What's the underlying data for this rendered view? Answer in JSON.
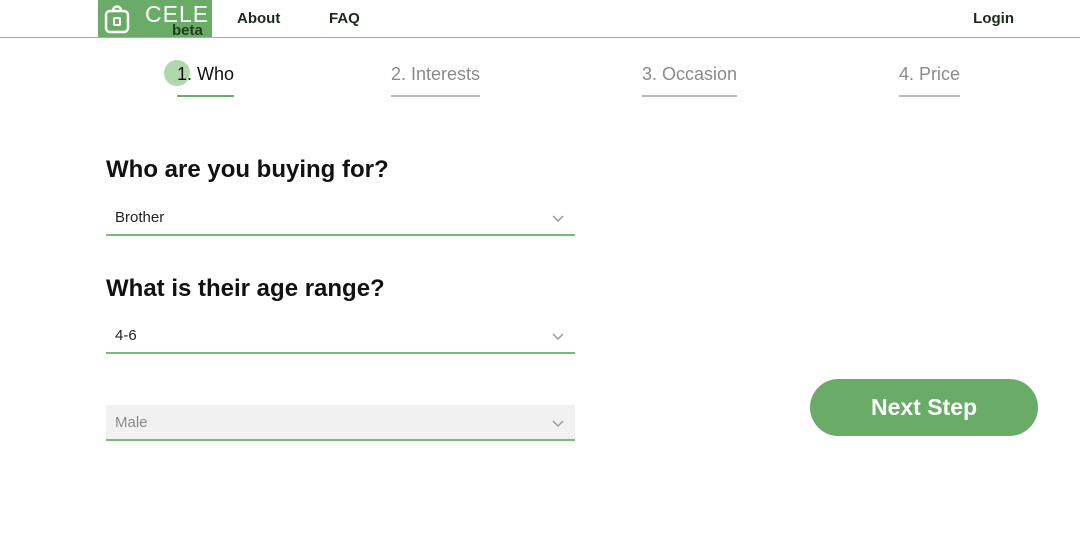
{
  "header": {
    "logo_text": "CELE",
    "logo_badge": "beta",
    "nav": {
      "about": "About",
      "faq": "FAQ",
      "login": "Login"
    }
  },
  "steps": [
    {
      "label": "1. Who",
      "active": true
    },
    {
      "label": "2. Interests",
      "active": false
    },
    {
      "label": "3. Occasion",
      "active": false
    },
    {
      "label": "4. Price",
      "active": false
    }
  ],
  "form": {
    "question_who": "Who are you buying for?",
    "who_value": "Brother",
    "question_age": "What is their age range?",
    "age_value": "4-6",
    "gender_value": "Male"
  },
  "actions": {
    "next_label": "Next Step"
  },
  "colors": {
    "accent": "#6aab68",
    "accent_light": "#a8d3a3",
    "muted": "#8a8a8a"
  }
}
